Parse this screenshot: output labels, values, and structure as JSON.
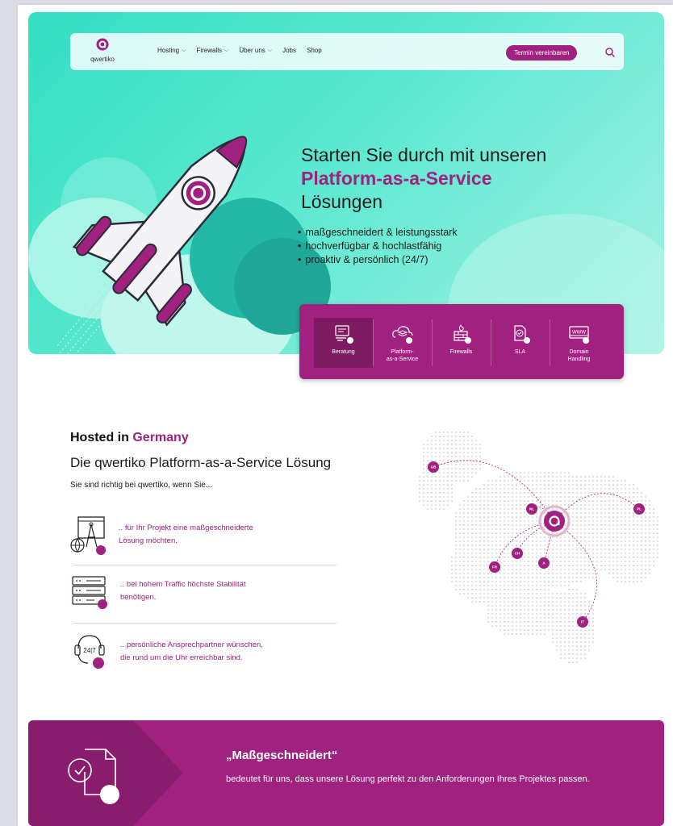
{
  "header": {
    "logo_text": "qwertiko",
    "nav": [
      {
        "label": "Hosting",
        "has_dropdown": true
      },
      {
        "label": "Firewalls",
        "has_dropdown": true
      },
      {
        "label": "Über uns",
        "has_dropdown": true
      },
      {
        "label": "Jobs",
        "has_dropdown": false
      },
      {
        "label": "Shop",
        "has_dropdown": false
      }
    ],
    "cta_label": "Termin vereinbaren",
    "search_icon": "search-icon"
  },
  "hero": {
    "title_line1": "Starten Sie durch mit unseren",
    "title_accent": "Platform-as-a-Service",
    "title_line3": "Lösungen",
    "bullets": [
      "maßgeschneidert & leistungsstark",
      "hochverfügbar & hochlastfähig",
      "proaktiv & persönlich (24/7)"
    ]
  },
  "services": [
    {
      "label": "Beratung",
      "icon": "consulting-icon",
      "active": true
    },
    {
      "label": "Platform-\nas-a-Service",
      "icon": "paas-icon",
      "active": false
    },
    {
      "label": "Firewalls",
      "icon": "firewall-icon",
      "active": false
    },
    {
      "label": "SLA",
      "icon": "sla-icon",
      "active": false
    },
    {
      "label": "Domain\nHandling",
      "icon": "domain-icon",
      "active": false
    }
  ],
  "hosted": {
    "heading_prefix": "Hosted in ",
    "heading_accent": "Germany",
    "subtitle": "Die qwertiko Platform-as-a-Service Lösung",
    "intro": "Sie sind richtig bei qwertiko, wenn Sie...",
    "features": [
      {
        "line1": ".. für Ihr Projekt eine maßgeschneiderte",
        "line2": "Lösung möchten.",
        "icon": "project-icon"
      },
      {
        "line1": ".. bei hohem Traffic höchste Stabilität",
        "line2": "benötigen.",
        "icon": "server-icon"
      },
      {
        "line1": ".. persönliche Ansprechpartner  wünschen,",
        "line2": "die rund um die Uhr erreichbar sind.",
        "icon": "support-24-7-icon",
        "icon_text": "24|7"
      }
    ]
  },
  "map": {
    "markers": [
      "GB",
      "NL",
      "PL",
      "CH",
      "A",
      "FR",
      "IT"
    ]
  },
  "banner": {
    "title": "„Maßgeschneidert“",
    "text": "bedeutet für uns, dass unsere Lösung perfekt zu den Anforderungen Ihres Projektes passen."
  },
  "colors": {
    "brand": "#a0217f",
    "teal": "#33dfc3"
  }
}
